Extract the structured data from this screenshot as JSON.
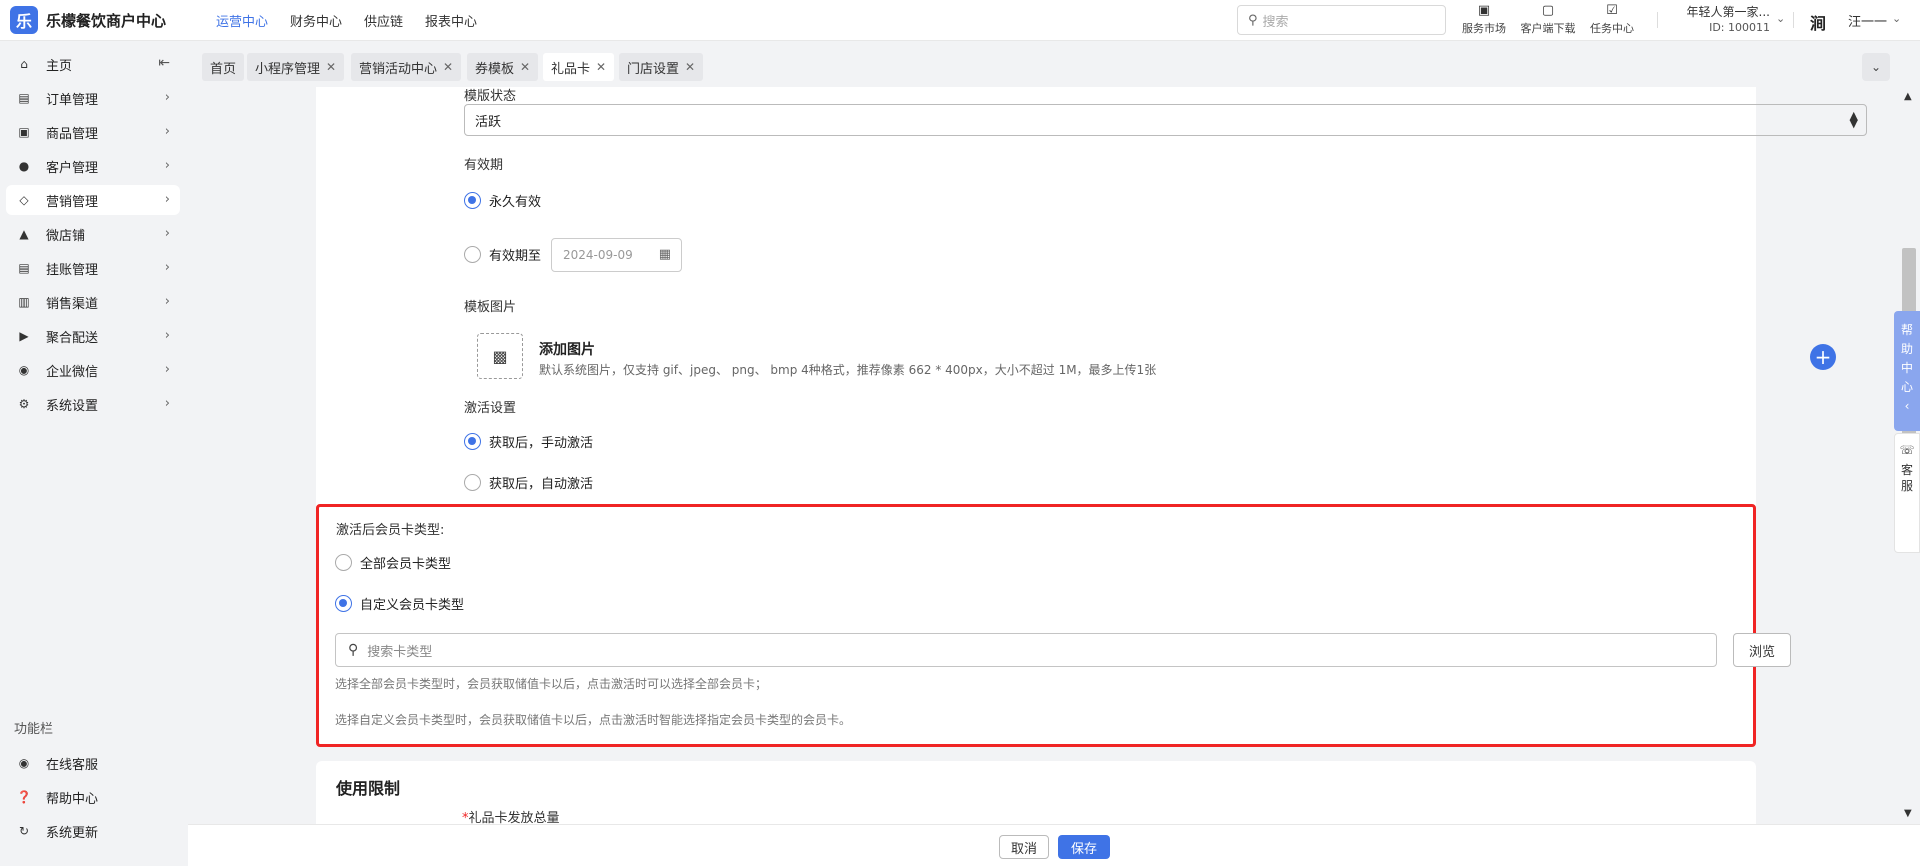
{
  "app": {
    "logo_glyph": "乐",
    "title": "乐檬餐饮商户中心"
  },
  "topnav": [
    "运营中心",
    "财务中心",
    "供应链",
    "报表中心"
  ],
  "top_search": {
    "placeholder": "搜索"
  },
  "tools": [
    {
      "icon": "market-icon",
      "label": "服务市场"
    },
    {
      "icon": "download-icon",
      "label": "客户端下载"
    },
    {
      "icon": "task-icon",
      "label": "任务中心"
    }
  ],
  "tenant": {
    "name": "年轻人第一家...",
    "id": "ID: 100011"
  },
  "user": {
    "brand_glyph": "涧",
    "name": "汪一一"
  },
  "sidebar": {
    "items": [
      {
        "icon": "home-icon",
        "label": "主页"
      },
      {
        "icon": "order-icon",
        "label": "订单管理"
      },
      {
        "icon": "goods-icon",
        "label": "商品管理"
      },
      {
        "icon": "customer-icon",
        "label": "客户管理"
      },
      {
        "icon": "marketing-icon",
        "label": "营销管理"
      },
      {
        "icon": "shop-icon",
        "label": "微店铺"
      },
      {
        "icon": "credit-icon",
        "label": "挂账管理"
      },
      {
        "icon": "channel-icon",
        "label": "销售渠道"
      },
      {
        "icon": "delivery-icon",
        "label": "聚合配送"
      },
      {
        "icon": "wechat-icon",
        "label": "企业微信"
      },
      {
        "icon": "settings-icon",
        "label": "系统设置"
      }
    ],
    "function_title": "功能栏",
    "function_items": [
      {
        "icon": "online-service-icon",
        "label": "在线客服"
      },
      {
        "icon": "help-icon",
        "label": "帮助中心"
      },
      {
        "icon": "update-icon",
        "label": "系统更新"
      }
    ]
  },
  "tabs": [
    "首页",
    "小程序管理",
    "营销活动中心",
    "券模板",
    "礼品卡",
    "门店设置"
  ],
  "form": {
    "template_status_label": "模版状态",
    "template_status_value": "活跃",
    "validity_label": "有效期",
    "validity_forever": "永久有效",
    "validity_until": "有效期至",
    "validity_date": "2024-09-09",
    "image_label": "模板图片",
    "image_add_title": "添加图片",
    "image_add_desc": "默认系统图片，仅支持 gif、jpeg、 png、 bmp 4种格式，推荐像素 662 * 400px，大小不超过 1M，最多上传1张",
    "activation_label": "激活设置",
    "activation_manual": "获取后，手动激活",
    "activation_auto": "获取后，自动激活",
    "member_type_label": "激活后会员卡类型:",
    "member_type_all": "全部会员卡类型",
    "member_type_custom": "自定义会员卡类型",
    "search_card_placeholder": "搜索卡类型",
    "browse_label": "浏览",
    "hint_all": "选择全部会员卡类型时，会员获取储值卡以后，点击激活时可以选择全部会员卡；",
    "hint_custom": "选择自定义会员卡类型时，会员获取储值卡以后，点击激活时智能选择指定会员卡类型的会员卡。",
    "usage_title": "使用限制",
    "total_issue_label": "礼品卡发放总量"
  },
  "float": {
    "help": [
      "帮",
      "助",
      "中",
      "心"
    ],
    "kefu": [
      "客",
      "服"
    ]
  },
  "footer": {
    "cancel": "取消",
    "save": "保存"
  }
}
